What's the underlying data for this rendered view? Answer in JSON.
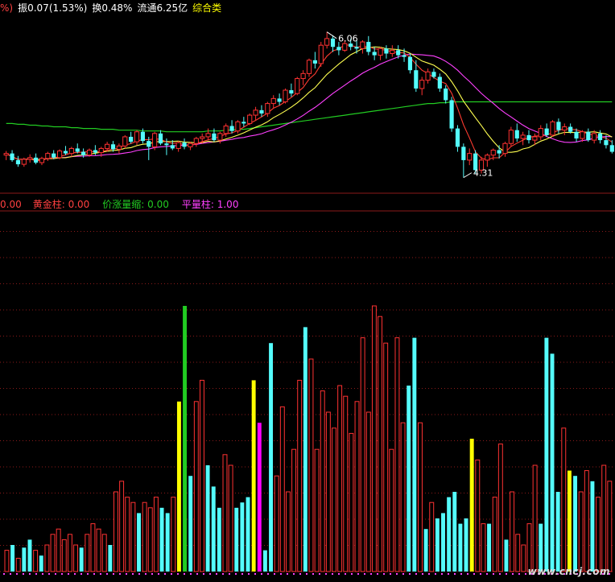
{
  "colors": {
    "bg": "#000000",
    "up": "#ff3232",
    "down": "#54fcfc",
    "ma_fast": "#ff3b30",
    "ma_mid": "#ffff50",
    "ma_slow": "#ff40ff",
    "ma_long": "#22cc22",
    "gold": "#ff2020",
    "bei": "#ffff00",
    "price_drop": "#22cc22",
    "flat": "#ff00ff",
    "marker": "#ff40ff",
    "grid": "#8b1a1a"
  },
  "header": {
    "pct_partial": "%)",
    "amplitude": "振0.07(1.53%)",
    "turnover": "换0.48%",
    "float_cap": "流通6.25亿",
    "category": "综合类"
  },
  "indicator_header": {
    "first_value": "0.00",
    "gold_bar": "黄金柱: 0.00",
    "price_up_vol_shrink": "价涨量缩: 0.00",
    "flat_bar": "平量柱: 1.00"
  },
  "watermark": "www.cncj.com",
  "chart_data": [
    {
      "type": "candlestick",
      "high_label": "6.06",
      "low_label": "4.31",
      "ylim": [
        4.2,
        6.25
      ],
      "candles": [
        [
          4.58,
          4.63,
          4.52,
          4.6
        ],
        [
          4.6,
          4.64,
          4.5,
          4.52
        ],
        [
          4.52,
          4.57,
          4.44,
          4.47
        ],
        [
          4.47,
          4.55,
          4.44,
          4.53
        ],
        [
          4.53,
          4.59,
          4.49,
          4.55
        ],
        [
          4.55,
          4.6,
          4.47,
          4.49
        ],
        [
          4.49,
          4.56,
          4.46,
          4.54
        ],
        [
          4.54,
          4.62,
          4.51,
          4.6
        ],
        [
          4.6,
          4.64,
          4.53,
          4.55
        ],
        [
          4.55,
          4.65,
          4.53,
          4.63
        ],
        [
          4.63,
          4.69,
          4.58,
          4.6
        ],
        [
          4.6,
          4.68,
          4.56,
          4.66
        ],
        [
          4.66,
          4.72,
          4.6,
          4.62
        ],
        [
          4.62,
          4.66,
          4.55,
          4.58
        ],
        [
          4.58,
          4.66,
          4.56,
          4.64
        ],
        [
          4.64,
          4.7,
          4.58,
          4.61
        ],
        [
          4.61,
          4.68,
          4.56,
          4.66
        ],
        [
          4.66,
          4.74,
          4.62,
          4.71
        ],
        [
          4.71,
          4.75,
          4.62,
          4.65
        ],
        [
          4.65,
          4.72,
          4.6,
          4.69
        ],
        [
          4.69,
          4.82,
          4.66,
          4.8
        ],
        [
          4.8,
          4.86,
          4.72,
          4.74
        ],
        [
          4.74,
          4.88,
          4.7,
          4.86
        ],
        [
          4.86,
          4.9,
          4.72,
          4.75
        ],
        [
          4.75,
          4.8,
          4.52,
          4.68
        ],
        [
          4.68,
          4.86,
          4.64,
          4.84
        ],
        [
          4.84,
          4.88,
          4.7,
          4.72
        ],
        [
          4.72,
          4.78,
          4.58,
          4.7
        ],
        [
          4.7,
          4.76,
          4.64,
          4.66
        ],
        [
          4.66,
          4.75,
          4.62,
          4.73
        ],
        [
          4.73,
          4.78,
          4.65,
          4.68
        ],
        [
          4.68,
          4.74,
          4.64,
          4.72
        ],
        [
          4.72,
          4.8,
          4.68,
          4.78
        ],
        [
          4.78,
          4.84,
          4.72,
          4.8
        ],
        [
          4.8,
          4.9,
          4.76,
          4.84
        ],
        [
          4.84,
          4.9,
          4.74,
          4.76
        ],
        [
          4.76,
          4.86,
          4.72,
          4.84
        ],
        [
          4.84,
          4.96,
          4.8,
          4.93
        ],
        [
          4.93,
          5.0,
          4.84,
          4.87
        ],
        [
          4.87,
          5.0,
          4.84,
          4.98
        ],
        [
          4.98,
          5.04,
          4.92,
          4.96
        ],
        [
          4.96,
          5.08,
          4.94,
          5.06
        ],
        [
          5.06,
          5.16,
          5.0,
          5.12
        ],
        [
          5.12,
          5.18,
          5.04,
          5.08
        ],
        [
          5.08,
          5.22,
          5.04,
          5.2
        ],
        [
          5.2,
          5.3,
          5.14,
          5.26
        ],
        [
          5.26,
          5.32,
          5.18,
          5.22
        ],
        [
          5.22,
          5.38,
          5.2,
          5.36
        ],
        [
          5.36,
          5.44,
          5.28,
          5.32
        ],
        [
          5.32,
          5.52,
          5.3,
          5.5
        ],
        [
          5.5,
          5.6,
          5.42,
          5.56
        ],
        [
          5.56,
          5.74,
          5.52,
          5.72
        ],
        [
          5.72,
          5.82,
          5.62,
          5.68
        ],
        [
          5.68,
          5.94,
          5.64,
          5.9
        ],
        [
          5.9,
          6.06,
          5.86,
          5.98
        ],
        [
          5.98,
          6.02,
          5.82,
          5.88
        ],
        [
          5.88,
          5.94,
          5.78,
          5.84
        ],
        [
          5.84,
          5.96,
          5.82,
          5.92
        ],
        [
          5.92,
          5.98,
          5.84,
          5.88
        ],
        [
          5.88,
          5.96,
          5.8,
          5.86
        ],
        [
          5.86,
          5.96,
          5.8,
          5.94
        ],
        [
          5.94,
          6.01,
          5.78,
          5.82
        ],
        [
          5.82,
          5.88,
          5.72,
          5.78
        ],
        [
          5.78,
          5.88,
          5.72,
          5.86
        ],
        [
          5.86,
          5.9,
          5.74,
          5.8
        ],
        [
          5.8,
          5.9,
          5.76,
          5.84
        ],
        [
          5.84,
          5.9,
          5.74,
          5.78
        ],
        [
          5.78,
          5.86,
          5.7,
          5.76
        ],
        [
          5.76,
          5.8,
          5.56,
          5.6
        ],
        [
          5.6,
          5.72,
          5.34,
          5.38
        ],
        [
          5.38,
          5.52,
          5.3,
          5.48
        ],
        [
          5.48,
          5.62,
          5.44,
          5.58
        ],
        [
          5.58,
          5.62,
          5.5,
          5.52
        ],
        [
          5.52,
          5.56,
          5.34,
          5.38
        ],
        [
          5.38,
          5.42,
          5.2,
          5.24
        ],
        [
          5.24,
          5.28,
          4.86,
          4.9
        ],
        [
          4.9,
          4.94,
          4.62,
          4.68
        ],
        [
          4.68,
          4.72,
          4.31,
          4.52
        ],
        [
          4.52,
          4.66,
          4.46,
          4.6
        ],
        [
          4.6,
          4.64,
          4.36,
          4.4
        ],
        [
          4.4,
          4.56,
          4.36,
          4.52
        ],
        [
          4.52,
          4.6,
          4.44,
          4.58
        ],
        [
          4.58,
          4.66,
          4.52,
          4.64
        ],
        [
          4.64,
          4.7,
          4.54,
          4.6
        ],
        [
          4.6,
          4.74,
          4.56,
          4.72
        ],
        [
          4.72,
          4.92,
          4.68,
          4.88
        ],
        [
          4.88,
          4.96,
          4.74,
          4.78
        ],
        [
          4.78,
          4.86,
          4.7,
          4.82
        ],
        [
          4.82,
          4.88,
          4.72,
          4.76
        ],
        [
          4.76,
          4.84,
          4.7,
          4.8
        ],
        [
          4.8,
          4.94,
          4.76,
          4.9
        ],
        [
          4.9,
          4.96,
          4.8,
          4.82
        ],
        [
          4.82,
          5.0,
          4.8,
          4.98
        ],
        [
          4.98,
          5.02,
          4.84,
          4.88
        ],
        [
          4.88,
          4.96,
          4.82,
          4.92
        ],
        [
          4.92,
          4.96,
          4.84,
          4.86
        ],
        [
          4.86,
          4.9,
          4.74,
          4.78
        ],
        [
          4.78,
          4.88,
          4.74,
          4.86
        ],
        [
          4.86,
          4.9,
          4.74,
          4.76
        ],
        [
          4.76,
          4.88,
          4.72,
          4.84
        ],
        [
          4.84,
          4.88,
          4.72,
          4.76
        ],
        [
          4.76,
          4.82,
          4.66,
          4.7
        ],
        [
          4.7,
          4.76,
          4.6,
          4.62
        ]
      ],
      "ma_long": [
        4.96,
        4.96,
        4.95,
        4.95,
        4.94,
        4.94,
        4.93,
        4.93,
        4.92,
        4.92,
        4.92,
        4.91,
        4.91,
        4.9,
        4.9,
        4.9,
        4.89,
        4.89,
        4.89,
        4.88,
        4.88,
        4.88,
        4.88,
        4.87,
        4.87,
        4.87,
        4.87,
        4.86,
        4.86,
        4.86,
        4.86,
        4.86,
        4.86,
        4.86,
        4.87,
        4.87,
        4.87,
        4.88,
        4.88,
        4.89,
        4.89,
        4.9,
        4.91,
        4.92,
        4.93,
        4.94,
        4.95,
        4.96,
        4.97,
        4.98,
        4.99,
        5.0,
        5.01,
        5.02,
        5.03,
        5.04,
        5.05,
        5.06,
        5.07,
        5.08,
        5.09,
        5.1,
        5.11,
        5.12,
        5.13,
        5.14,
        5.15,
        5.16,
        5.17,
        5.18,
        5.19,
        5.2,
        5.2,
        5.21,
        5.21,
        5.22,
        5.22,
        5.22,
        5.22,
        5.22,
        5.22,
        5.22,
        5.22,
        5.22,
        5.22,
        5.22,
        5.22,
        5.22,
        5.22,
        5.22,
        5.22,
        5.22,
        5.22,
        5.22,
        5.22,
        5.22,
        5.22,
        5.22,
        5.22,
        5.22,
        5.22,
        5.22,
        5.22
      ]
    },
    {
      "type": "bar",
      "values": [
        8,
        10,
        5,
        9,
        12,
        8,
        6,
        10,
        14,
        16,
        12,
        14,
        10,
        9,
        14,
        18,
        16,
        14,
        10,
        30,
        34,
        28,
        26,
        22,
        26,
        24,
        28,
        24,
        22,
        28,
        64,
        100,
        36,
        64,
        72,
        40,
        32,
        24,
        44,
        40,
        24,
        26,
        28,
        72,
        56,
        8,
        86,
        36,
        62,
        30,
        46,
        72,
        92,
        80,
        46,
        68,
        60,
        54,
        70,
        66,
        52,
        64,
        88,
        60,
        100,
        96,
        86,
        46,
        88,
        56,
        70,
        88,
        56,
        16,
        26,
        20,
        22,
        28,
        30,
        18,
        20,
        50,
        42,
        18,
        18,
        28,
        48,
        12,
        30,
        14,
        10,
        18,
        40,
        18,
        88,
        82,
        30,
        54,
        38,
        36,
        30,
        38,
        34,
        28,
        40,
        34
      ],
      "colors": [
        "u",
        "d",
        "u",
        "d",
        "d",
        "u",
        "d",
        "u",
        "u",
        "u",
        "u",
        "u",
        "u",
        "d",
        "u",
        "u",
        "u",
        "u",
        "d",
        "u",
        "u",
        "u",
        "u",
        "d",
        "u",
        "u",
        "u",
        "d",
        "d",
        "u",
        "y",
        "g",
        "d",
        "u",
        "u",
        "d",
        "d",
        "d",
        "u",
        "u",
        "d",
        "d",
        "d",
        "y",
        "p",
        "d",
        "d",
        "u",
        "u",
        "u",
        "u",
        "u",
        "d",
        "u",
        "u",
        "u",
        "u",
        "u",
        "u",
        "u",
        "u",
        "u",
        "u",
        "u",
        "u",
        "u",
        "u",
        "u",
        "u",
        "u",
        "d",
        "d",
        "u",
        "d",
        "u",
        "d",
        "d",
        "d",
        "d",
        "d",
        "d",
        "y",
        "u",
        "u",
        "d",
        "u",
        "u",
        "d",
        "u",
        "u",
        "u",
        "u",
        "u",
        "d",
        "d",
        "d",
        "d",
        "u",
        "y",
        "d",
        "u",
        "u",
        "d",
        "u",
        "u",
        "u"
      ],
      "labels": {}
    }
  ]
}
